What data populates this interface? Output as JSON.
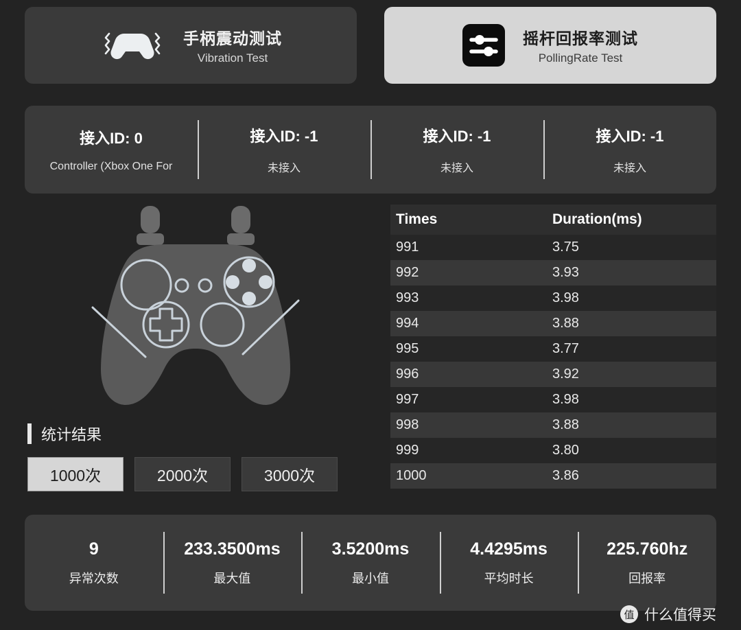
{
  "tabs": [
    {
      "title_cn": "手柄震动测试",
      "title_en": "Vibration Test",
      "icon": "gamepad-vibration-icon",
      "active": false
    },
    {
      "title_cn": "摇杆回报率测试",
      "title_en": "PollingRate Test",
      "icon": "sliders-icon",
      "active": true
    }
  ],
  "controllers": [
    {
      "id_label": "接入ID: 0",
      "name": "Controller (Xbox One For"
    },
    {
      "id_label": "接入ID: -1",
      "name": "未接入"
    },
    {
      "id_label": "接入ID: -1",
      "name": "未接入"
    },
    {
      "id_label": "接入ID: -1",
      "name": "未接入"
    }
  ],
  "gamepad": {
    "icon": "gamepad-illustration",
    "body_color": "#5a5a5a",
    "outline_color": "#c9d2da"
  },
  "statistics": {
    "section_label": "统计结果",
    "buttons": [
      {
        "label": "1000次",
        "active": true
      },
      {
        "label": "2000次",
        "active": false
      },
      {
        "label": "3000次",
        "active": false
      }
    ]
  },
  "table": {
    "headers": [
      "Times",
      "Duration(ms)"
    ],
    "rows": [
      [
        "991",
        "3.75"
      ],
      [
        "992",
        "3.93"
      ],
      [
        "993",
        "3.98"
      ],
      [
        "994",
        "3.88"
      ],
      [
        "995",
        "3.77"
      ],
      [
        "996",
        "3.92"
      ],
      [
        "997",
        "3.98"
      ],
      [
        "998",
        "3.88"
      ],
      [
        "999",
        "3.80"
      ],
      [
        "1000",
        "3.86"
      ]
    ]
  },
  "summary": [
    {
      "value": "9",
      "label": "异常次数"
    },
    {
      "value": "233.3500ms",
      "label": "最大值"
    },
    {
      "value": "3.5200ms",
      "label": "最小值"
    },
    {
      "value": "4.4295ms",
      "label": "平均时长"
    },
    {
      "value": "225.760hz",
      "label": "回报率"
    }
  ],
  "watermark": {
    "badge": "值",
    "text": "什么值得买"
  },
  "colors": {
    "page_bg": "#232323",
    "panel_bg": "#3a3a3a",
    "active_bg": "#d6d6d6",
    "row_odd": "#262626",
    "row_even": "#383838",
    "header_bg": "#2e2e2e"
  }
}
